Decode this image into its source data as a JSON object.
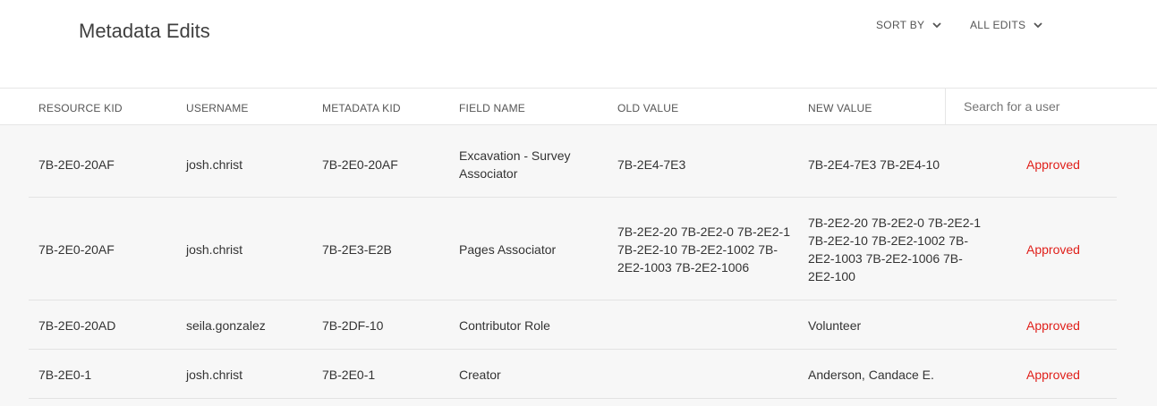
{
  "header": {
    "title": "Metadata Edits",
    "sort_label": "SORT BY",
    "filter_label": "ALL EDITS",
    "chevron_icon": "chevron-down-icon"
  },
  "columns": [
    "RESOURCE KID",
    "USERNAME",
    "METADATA KID",
    "FIELD NAME",
    "OLD VALUE",
    "NEW VALUE"
  ],
  "search": {
    "placeholder": "Search for a user",
    "value": ""
  },
  "colors": {
    "status_approved": "#e0201b",
    "rows_background": "#f7f7f7"
  },
  "rows": [
    {
      "resource_kid": "7B-2E0-20AF",
      "username": "josh.christ",
      "metadata_kid": "7B-2E0-20AF",
      "field_name": "Excavation - Survey Associator",
      "old_value": "7B-2E4-7E3",
      "new_value": "7B-2E4-7E3 7B-2E4-10",
      "status": "Approved"
    },
    {
      "resource_kid": "7B-2E0-20AF",
      "username": "josh.christ",
      "metadata_kid": "7B-2E3-E2B",
      "field_name": "Pages Associator",
      "old_value": "7B-2E2-20 7B-2E2-0 7B-2E2-1 7B-2E2-10 7B-2E2-1002 7B-2E2-1003 7B-2E2-1006",
      "new_value": "7B-2E2-20 7B-2E2-0 7B-2E2-1 7B-2E2-10 7B-2E2-1002 7B-2E2-1003 7B-2E2-1006 7B-2E2-100",
      "status": "Approved"
    },
    {
      "resource_kid": "7B-2E0-20AD",
      "username": "seila.gonzalez",
      "metadata_kid": "7B-2DF-10",
      "field_name": "Contributor Role",
      "old_value": "",
      "new_value": "Volunteer",
      "status": "Approved"
    },
    {
      "resource_kid": "7B-2E0-1",
      "username": "josh.christ",
      "metadata_kid": "7B-2E0-1",
      "field_name": "Creator",
      "old_value": "",
      "new_value": "Anderson, Candace E.",
      "status": "Approved"
    }
  ]
}
